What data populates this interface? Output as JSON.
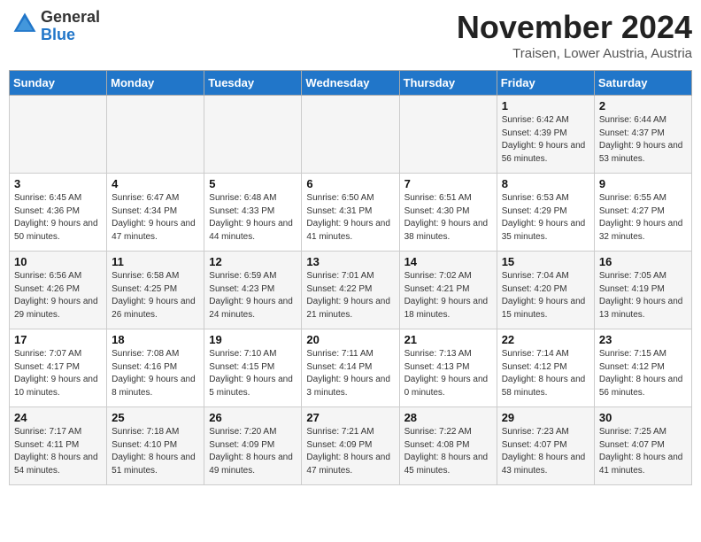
{
  "logo": {
    "general": "General",
    "blue": "Blue"
  },
  "header": {
    "month_title": "November 2024",
    "location": "Traisen, Lower Austria, Austria"
  },
  "weekdays": [
    "Sunday",
    "Monday",
    "Tuesday",
    "Wednesday",
    "Thursday",
    "Friday",
    "Saturday"
  ],
  "weeks": [
    [
      {
        "day": "",
        "sunrise": "",
        "sunset": "",
        "daylight": ""
      },
      {
        "day": "",
        "sunrise": "",
        "sunset": "",
        "daylight": ""
      },
      {
        "day": "",
        "sunrise": "",
        "sunset": "",
        "daylight": ""
      },
      {
        "day": "",
        "sunrise": "",
        "sunset": "",
        "daylight": ""
      },
      {
        "day": "",
        "sunrise": "",
        "sunset": "",
        "daylight": ""
      },
      {
        "day": "1",
        "sunrise": "Sunrise: 6:42 AM",
        "sunset": "Sunset: 4:39 PM",
        "daylight": "Daylight: 9 hours and 56 minutes."
      },
      {
        "day": "2",
        "sunrise": "Sunrise: 6:44 AM",
        "sunset": "Sunset: 4:37 PM",
        "daylight": "Daylight: 9 hours and 53 minutes."
      }
    ],
    [
      {
        "day": "3",
        "sunrise": "Sunrise: 6:45 AM",
        "sunset": "Sunset: 4:36 PM",
        "daylight": "Daylight: 9 hours and 50 minutes."
      },
      {
        "day": "4",
        "sunrise": "Sunrise: 6:47 AM",
        "sunset": "Sunset: 4:34 PM",
        "daylight": "Daylight: 9 hours and 47 minutes."
      },
      {
        "day": "5",
        "sunrise": "Sunrise: 6:48 AM",
        "sunset": "Sunset: 4:33 PM",
        "daylight": "Daylight: 9 hours and 44 minutes."
      },
      {
        "day": "6",
        "sunrise": "Sunrise: 6:50 AM",
        "sunset": "Sunset: 4:31 PM",
        "daylight": "Daylight: 9 hours and 41 minutes."
      },
      {
        "day": "7",
        "sunrise": "Sunrise: 6:51 AM",
        "sunset": "Sunset: 4:30 PM",
        "daylight": "Daylight: 9 hours and 38 minutes."
      },
      {
        "day": "8",
        "sunrise": "Sunrise: 6:53 AM",
        "sunset": "Sunset: 4:29 PM",
        "daylight": "Daylight: 9 hours and 35 minutes."
      },
      {
        "day": "9",
        "sunrise": "Sunrise: 6:55 AM",
        "sunset": "Sunset: 4:27 PM",
        "daylight": "Daylight: 9 hours and 32 minutes."
      }
    ],
    [
      {
        "day": "10",
        "sunrise": "Sunrise: 6:56 AM",
        "sunset": "Sunset: 4:26 PM",
        "daylight": "Daylight: 9 hours and 29 minutes."
      },
      {
        "day": "11",
        "sunrise": "Sunrise: 6:58 AM",
        "sunset": "Sunset: 4:25 PM",
        "daylight": "Daylight: 9 hours and 26 minutes."
      },
      {
        "day": "12",
        "sunrise": "Sunrise: 6:59 AM",
        "sunset": "Sunset: 4:23 PM",
        "daylight": "Daylight: 9 hours and 24 minutes."
      },
      {
        "day": "13",
        "sunrise": "Sunrise: 7:01 AM",
        "sunset": "Sunset: 4:22 PM",
        "daylight": "Daylight: 9 hours and 21 minutes."
      },
      {
        "day": "14",
        "sunrise": "Sunrise: 7:02 AM",
        "sunset": "Sunset: 4:21 PM",
        "daylight": "Daylight: 9 hours and 18 minutes."
      },
      {
        "day": "15",
        "sunrise": "Sunrise: 7:04 AM",
        "sunset": "Sunset: 4:20 PM",
        "daylight": "Daylight: 9 hours and 15 minutes."
      },
      {
        "day": "16",
        "sunrise": "Sunrise: 7:05 AM",
        "sunset": "Sunset: 4:19 PM",
        "daylight": "Daylight: 9 hours and 13 minutes."
      }
    ],
    [
      {
        "day": "17",
        "sunrise": "Sunrise: 7:07 AM",
        "sunset": "Sunset: 4:17 PM",
        "daylight": "Daylight: 9 hours and 10 minutes."
      },
      {
        "day": "18",
        "sunrise": "Sunrise: 7:08 AM",
        "sunset": "Sunset: 4:16 PM",
        "daylight": "Daylight: 9 hours and 8 minutes."
      },
      {
        "day": "19",
        "sunrise": "Sunrise: 7:10 AM",
        "sunset": "Sunset: 4:15 PM",
        "daylight": "Daylight: 9 hours and 5 minutes."
      },
      {
        "day": "20",
        "sunrise": "Sunrise: 7:11 AM",
        "sunset": "Sunset: 4:14 PM",
        "daylight": "Daylight: 9 hours and 3 minutes."
      },
      {
        "day": "21",
        "sunrise": "Sunrise: 7:13 AM",
        "sunset": "Sunset: 4:13 PM",
        "daylight": "Daylight: 9 hours and 0 minutes."
      },
      {
        "day": "22",
        "sunrise": "Sunrise: 7:14 AM",
        "sunset": "Sunset: 4:12 PM",
        "daylight": "Daylight: 8 hours and 58 minutes."
      },
      {
        "day": "23",
        "sunrise": "Sunrise: 7:15 AM",
        "sunset": "Sunset: 4:12 PM",
        "daylight": "Daylight: 8 hours and 56 minutes."
      }
    ],
    [
      {
        "day": "24",
        "sunrise": "Sunrise: 7:17 AM",
        "sunset": "Sunset: 4:11 PM",
        "daylight": "Daylight: 8 hours and 54 minutes."
      },
      {
        "day": "25",
        "sunrise": "Sunrise: 7:18 AM",
        "sunset": "Sunset: 4:10 PM",
        "daylight": "Daylight: 8 hours and 51 minutes."
      },
      {
        "day": "26",
        "sunrise": "Sunrise: 7:20 AM",
        "sunset": "Sunset: 4:09 PM",
        "daylight": "Daylight: 8 hours and 49 minutes."
      },
      {
        "day": "27",
        "sunrise": "Sunrise: 7:21 AM",
        "sunset": "Sunset: 4:09 PM",
        "daylight": "Daylight: 8 hours and 47 minutes."
      },
      {
        "day": "28",
        "sunrise": "Sunrise: 7:22 AM",
        "sunset": "Sunset: 4:08 PM",
        "daylight": "Daylight: 8 hours and 45 minutes."
      },
      {
        "day": "29",
        "sunrise": "Sunrise: 7:23 AM",
        "sunset": "Sunset: 4:07 PM",
        "daylight": "Daylight: 8 hours and 43 minutes."
      },
      {
        "day": "30",
        "sunrise": "Sunrise: 7:25 AM",
        "sunset": "Sunset: 4:07 PM",
        "daylight": "Daylight: 8 hours and 41 minutes."
      }
    ]
  ]
}
